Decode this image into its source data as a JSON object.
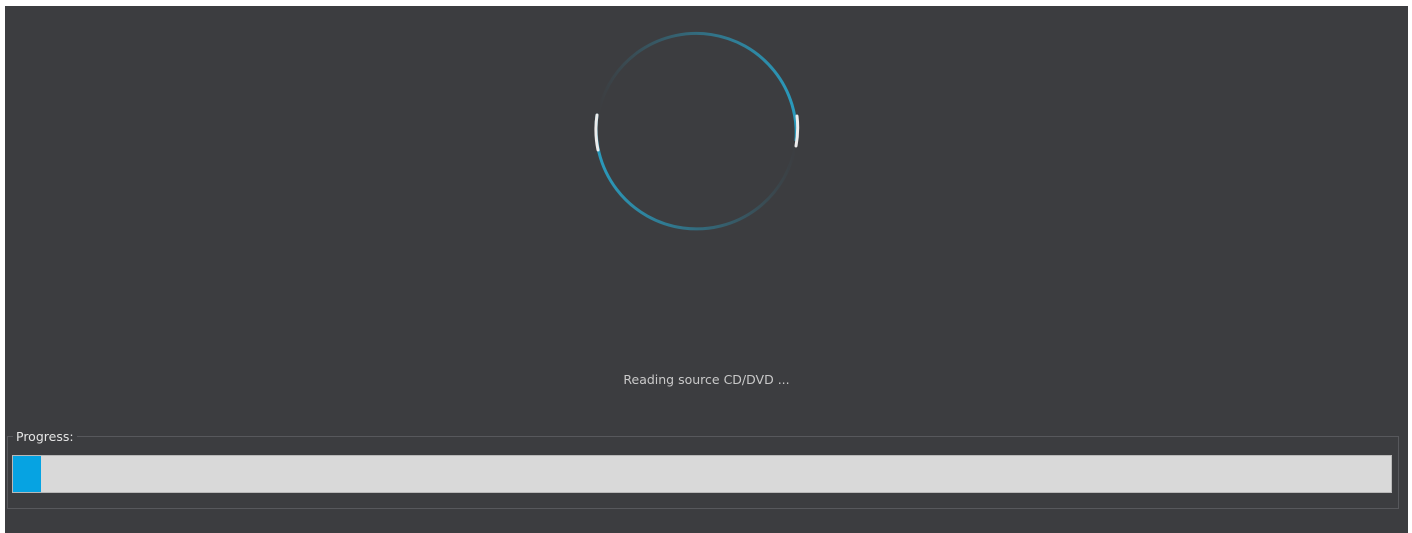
{
  "status": {
    "message": "Reading source CD/DVD ..."
  },
  "spinner": {
    "icon": "loading-spinner-icon",
    "ring_color": "#2a9bbd",
    "highlight_color": "#e8e8e8"
  },
  "progress": {
    "label": "Progress:",
    "value_fraction": 0.02,
    "fill_color": "#06a3e2",
    "track_color": "#d9d9d9"
  }
}
